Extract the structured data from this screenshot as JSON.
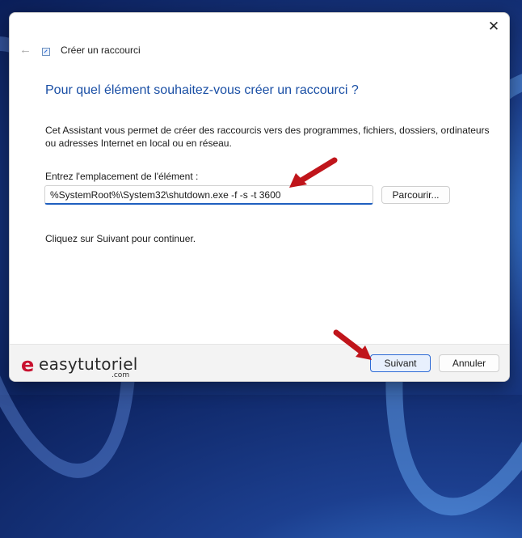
{
  "wizard": {
    "title": "Créer un raccourci",
    "close_glyph": "✕",
    "back_glyph": "←",
    "heading": "Pour quel élément souhaitez-vous créer un raccourci ?",
    "description": "Cet Assistant vous permet de créer des raccourcis vers des programmes, fichiers, dossiers, ordinateurs ou adresses Internet en local ou en réseau.",
    "location_label": "Entrez l'emplacement de l'élément :",
    "location_value": "%SystemRoot%\\System32\\shutdown.exe -f -s -t 3600",
    "browse_label": "Parcourir...",
    "hint": "Cliquez sur Suivant pour continuer.",
    "next_label": "Suivant",
    "cancel_label": "Annuler"
  },
  "watermark": {
    "mark": "e",
    "brand": "easytutoriel",
    "suffix": ".com"
  },
  "annotations": {
    "arrow_color": "#c0151b"
  },
  "icons": [
    "close-icon",
    "back-arrow-icon",
    "shortcut-wizard-icon",
    "red-pointer-arrow-icon"
  ]
}
